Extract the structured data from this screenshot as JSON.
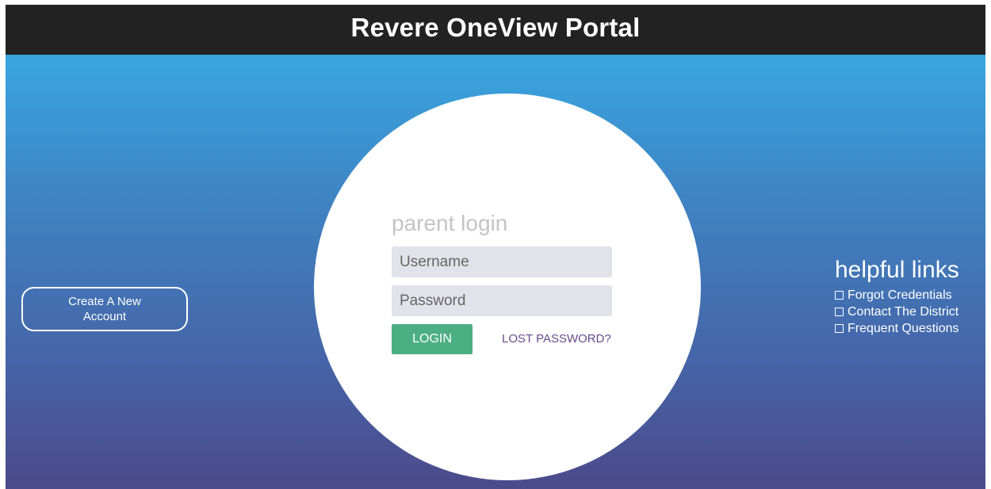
{
  "header": {
    "title": "Revere OneView Portal"
  },
  "sidebar_left": {
    "create_account_label": "Create A New Account"
  },
  "login": {
    "title": "parent login",
    "username_placeholder": "Username",
    "password_placeholder": "Password",
    "login_button": "LOGIN",
    "lost_password_link": "LOST PASSWORD?"
  },
  "helpful_links": {
    "title": "helpful links",
    "items": [
      {
        "icon": "square-outline-icon",
        "label": "Forgot Credentials"
      },
      {
        "icon": "square-outline-icon",
        "label": "Contact The District"
      },
      {
        "icon": "square-outline-icon",
        "label": "Frequent Questions"
      }
    ]
  },
  "colors": {
    "header_bg": "#222222",
    "gradient_top": "#38a6e0",
    "gradient_bottom": "#4b4a8a",
    "login_button": "#4caf83",
    "lost_password": "#6a4a8c",
    "field_bg": "#e2e2ea"
  }
}
